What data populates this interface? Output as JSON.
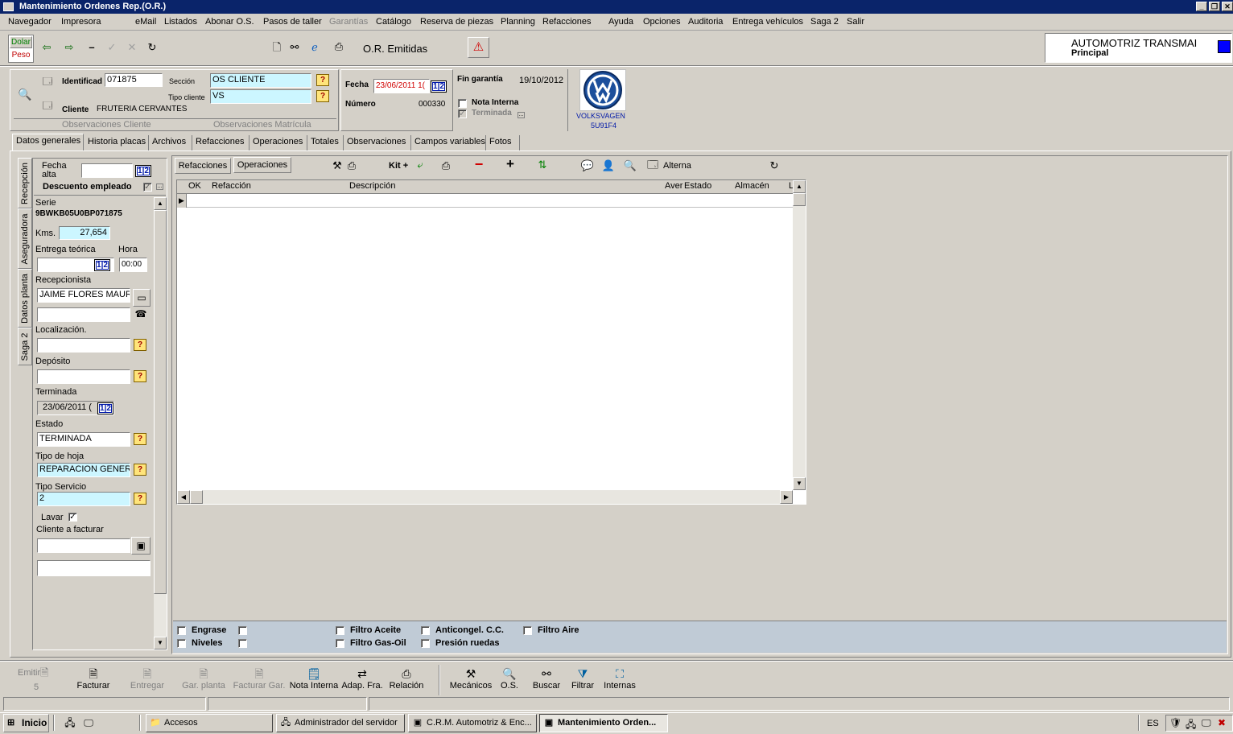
{
  "window": {
    "title": "Mantenimiento Ordenes Rep.(O.R.)"
  },
  "menu": [
    {
      "label": "Navegador",
      "disabled": false
    },
    {
      "label": "Impresora",
      "disabled": false
    },
    {
      "label": "eMail",
      "disabled": false
    },
    {
      "label": "Listados",
      "disabled": false
    },
    {
      "label": "Abonar O.S.",
      "disabled": false
    },
    {
      "label": "Pasos de taller",
      "disabled": false
    },
    {
      "label": "Garantías",
      "disabled": true
    },
    {
      "label": "Catálogo",
      "disabled": false
    },
    {
      "label": "Reserva de piezas",
      "disabled": false
    },
    {
      "label": "Planning",
      "disabled": false
    },
    {
      "label": "Refacciones",
      "disabled": false
    },
    {
      "label": "Ayuda",
      "disabled": false
    },
    {
      "label": "Opciones",
      "disabled": false
    },
    {
      "label": "Auditoria",
      "disabled": false
    },
    {
      "label": "Entrega vehículos",
      "disabled": false
    },
    {
      "label": "Saga 2",
      "disabled": false
    },
    {
      "label": "Salir",
      "disabled": false
    }
  ],
  "toolbar": {
    "currency_dolar": "Dolar",
    "currency_peso": "Peso",
    "title": "O.R. Emitidas"
  },
  "company": {
    "name": "AUTOMOTRIZ TRANSMAI",
    "branch": "Principal"
  },
  "header": {
    "identificador_label": "Identificad",
    "identificador_value": "071875",
    "seccion_label": "Sección",
    "seccion_value": "OS CLIENTE",
    "tipo_cliente_label": "Tipo cliente",
    "tipo_cliente_value": "VS",
    "cliente_label": "Cliente",
    "cliente_value": "FRUTERIA CERVANTES",
    "obs_cliente": "Observaciones  Cliente",
    "obs_matricula": "Observaciones  Matrícula",
    "fecha_label": "Fecha",
    "fecha_value": "23/06/2011 1(",
    "numero_label": "Número",
    "numero_value": "000330",
    "fin_garantia_label": "Fin garantía",
    "fin_garantia_value": "19/10/2012",
    "nota_interna_label": "Nota Interna",
    "terminada_label": "Terminada",
    "brand_name": "VOLKSVAGEN",
    "brand_code": "5U91F4",
    "cal_text": "1|2"
  },
  "tabs": [
    "Datos generales",
    "Historia placas",
    "Archivos",
    "Refacciones",
    "Operaciones",
    "Totales",
    "Observaciones",
    "Campos variables",
    "Fotos"
  ],
  "side_tabs": [
    "Recepción",
    "Aseguradora",
    "Datos planta",
    "Saga 2"
  ],
  "left_panel": {
    "fecha_alta_label": "Fecha alta",
    "descuento_label": "Descuento empleado",
    "serie_label": "Serie",
    "serie_value": "9BWKB05U0BP071875",
    "kms_label": "Kms.",
    "kms_value": "27,654",
    "entrega_label": "Entrega teórica",
    "hora_label": "Hora",
    "hora_value": "00:00",
    "recepcionista_label": "Recepcionista",
    "recepcionista_value": "JAIME FLORES MAUR",
    "localizacion_label": "Localización.",
    "deposito_label": "Depósito",
    "terminada_label": "Terminada",
    "terminada_value": "23/06/2011 (",
    "estado_label": "Estado",
    "estado_value": "TERMINADA",
    "tipo_hoja_label": "Tipo de hoja",
    "tipo_hoja_value": "REPARACION GENER",
    "tipo_servicio_label": "Tipo Servicio",
    "tipo_servicio_value": "2",
    "lavar_label": "Lavar",
    "cliente_facturar_label": "Cliente a facturar"
  },
  "grid": {
    "subtabs": [
      "Refacciones",
      "Operaciones"
    ],
    "kit_label": "Kit +",
    "alterna_label": "Alterna",
    "columns": [
      "OK",
      "Refacción",
      "Descripción",
      "Aver",
      "Estado",
      "Almacén",
      "L"
    ]
  },
  "checks": [
    {
      "label": "Engrase"
    },
    {
      "label": "Niveles"
    },
    {
      "label": "Filtro Aceite"
    },
    {
      "label": "Filtro Gas-Oil"
    },
    {
      "label": "Anticongel. C.C."
    },
    {
      "label": "Presión ruedas"
    },
    {
      "label": "Filtro Aire"
    }
  ],
  "bottom_toolbar": [
    {
      "label": "Emitir",
      "icon": "document-icon",
      "disabled": true
    },
    {
      "label": "Facturar",
      "icon": "document-icon",
      "disabled": false
    },
    {
      "label": "Entregar",
      "icon": "document-icon",
      "disabled": true
    },
    {
      "label": "Gar. planta",
      "icon": "document-icon",
      "disabled": true
    },
    {
      "label": "Facturar Gar.",
      "icon": "document-icon",
      "disabled": true
    },
    {
      "label": "Nota Interna",
      "icon": "note-icon",
      "disabled": false
    },
    {
      "label": "Adap. Fra.",
      "icon": "adapt-icon",
      "disabled": false
    },
    {
      "label": "Relación",
      "icon": "printer-icon",
      "disabled": false
    },
    {
      "label": "Mecánicos",
      "icon": "mechanic-icon",
      "disabled": false
    },
    {
      "label": "O.S.",
      "icon": "magnifier-icon",
      "disabled": false
    },
    {
      "label": "Buscar",
      "icon": "binoculars-icon",
      "disabled": false
    },
    {
      "label": "Filtrar",
      "icon": "filter-icon",
      "disabled": false
    },
    {
      "label": "Internas",
      "icon": "network-icon",
      "disabled": false
    }
  ],
  "emitir_count": "5",
  "taskbar": {
    "start": "Inicio",
    "tasks": [
      "Accesos",
      "Administrador del servidor",
      "C.R.M. Automotriz & Enc...",
      "Mantenimiento Orden..."
    ],
    "lang": "ES"
  }
}
